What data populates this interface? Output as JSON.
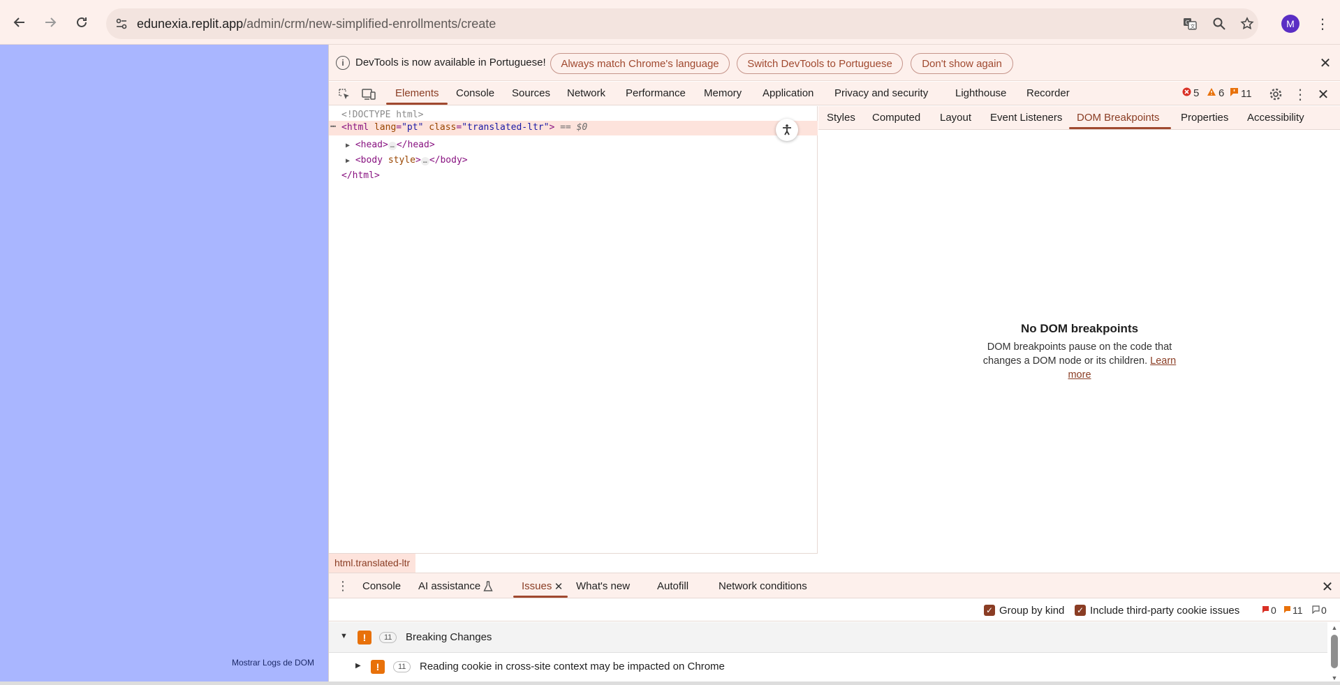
{
  "browser": {
    "url_host": "edunexia.replit.app",
    "url_path": "/admin/crm/new-simplified-enrollments/create",
    "avatar_letter": "M",
    "icons": [
      "back-icon",
      "forward-icon",
      "reload-icon",
      "site-settings-icon",
      "translate-icon",
      "zoom-icon",
      "bookmark-star-icon",
      "more-vert-icon"
    ]
  },
  "page": {
    "dom_logs_label": "Mostrar Logs de DOM",
    "background_color": "#a9b6ff"
  },
  "infobar": {
    "message": "DevTools is now available in Portuguese!",
    "btn_match": "Always match Chrome's language",
    "btn_switch": "Switch DevTools to Portuguese",
    "btn_dont_show": "Don't show again"
  },
  "devtools": {
    "tabs": [
      "Elements",
      "Console",
      "Sources",
      "Network",
      "Performance",
      "Memory",
      "Application",
      "Privacy and security",
      "Lighthouse",
      "Recorder"
    ],
    "active_tab": "Elements",
    "errors": "5",
    "warnings": "6",
    "issues": "11",
    "accent_color": "#a0492f"
  },
  "elements": {
    "doctype": "<!DOCTYPE html>",
    "html_open_tag": "<html",
    "html_lang_name": "lang",
    "html_lang_value": "\"pt\"",
    "html_class_name": "class",
    "html_class_value": "\"translated-ltr\"",
    "html_close_bracket": ">",
    "selected_marker": "== $0",
    "head_open": "<head>",
    "head_close": "</head>",
    "body_open": "<body",
    "body_style_attr": "style",
    "body_close_bracket": ">",
    "body_close": "</body>",
    "html_close": "</html>",
    "ellipsis": "…",
    "breadcrumb": "html.translated-ltr"
  },
  "sidebar": {
    "tabs": [
      "Styles",
      "Computed",
      "Layout",
      "Event Listeners",
      "DOM Breakpoints",
      "Properties",
      "Accessibility"
    ],
    "active_tab": "DOM Breakpoints",
    "empty_title": "No DOM breakpoints",
    "empty_desc": "DOM breakpoints pause on the code that changes a DOM node or its children.",
    "learn_more": "Learn more"
  },
  "drawer": {
    "tabs": [
      "Console",
      "AI assistance",
      "Issues",
      "What's new",
      "Autofill",
      "Network conditions"
    ],
    "active_tab": "Issues",
    "group_by_kind_label": "Group by kind",
    "third_party_label": "Include third-party cookie issues",
    "count_errors": "0",
    "count_warnings": "11",
    "count_info": "0",
    "group_count": "11",
    "group_title": "Breaking Changes",
    "issue_count": "11",
    "issue_title": "Reading cookie in cross-site context may be impacted on Chrome"
  }
}
